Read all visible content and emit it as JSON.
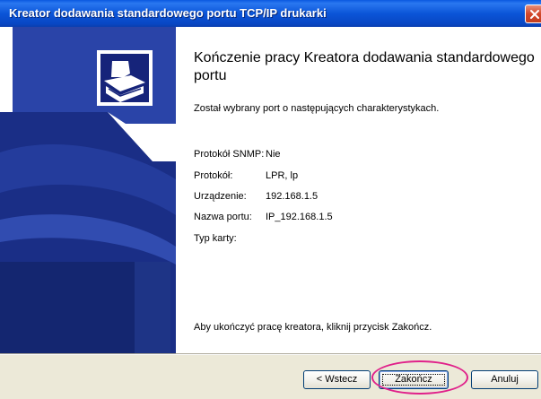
{
  "window": {
    "title": "Kreator dodawania standardowego portu TCP/IP drukarki"
  },
  "page": {
    "heading": "Kończenie pracy Kreatora dodawania standardowego portu",
    "intro": "Został wybrany port o następujących charakterystykach.",
    "details": [
      {
        "label": "Protokół SNMP:",
        "value": "Nie"
      },
      {
        "label": "Protokół:",
        "value": "LPR, lp"
      },
      {
        "label": "Urządzenie:",
        "value": "192.168.1.5"
      },
      {
        "label": "Nazwa portu:",
        "value": "IP_192.168.1.5"
      },
      {
        "label": "Typ karty:",
        "value": ""
      }
    ],
    "instruction": "Aby ukończyć pracę kreatora, kliknij przycisk Zakończ."
  },
  "buttons": {
    "back": "< Wstecz",
    "finish": "Zakończ",
    "cancel": "Anuluj"
  },
  "colors": {
    "titlebar": "#0b55d8",
    "sidebar_art": "#1a2e86",
    "highlight": "#e0218a",
    "footer": "#ece9d8"
  }
}
